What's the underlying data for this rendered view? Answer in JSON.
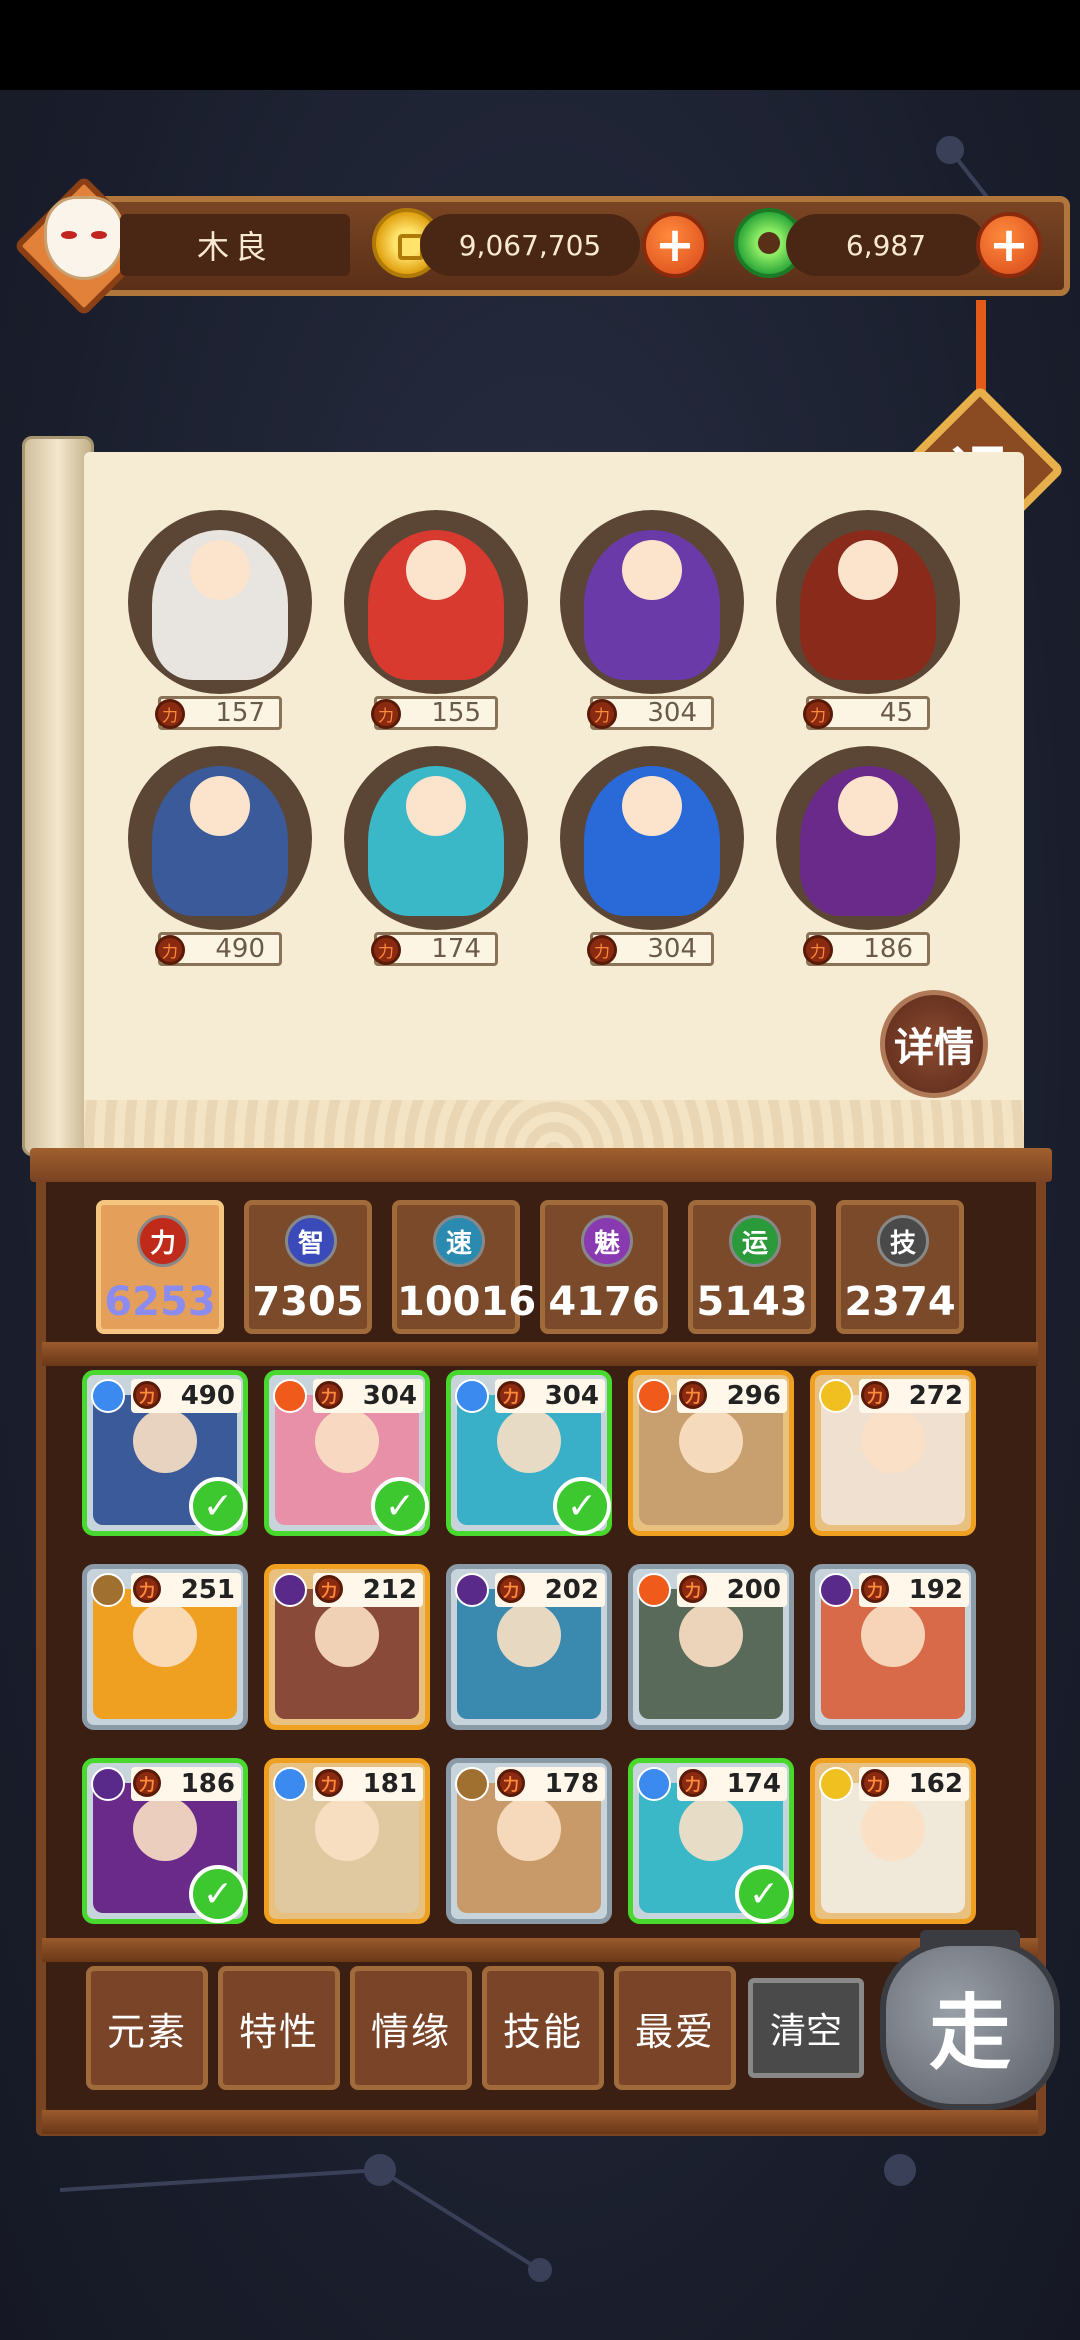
{
  "player": {
    "name": "木良"
  },
  "currency": {
    "gold": "9,067,705",
    "jade": "6,987"
  },
  "buttons": {
    "exit": "退",
    "detail": "详情",
    "go": "走",
    "clear": "清空",
    "plus": "+"
  },
  "team": [
    {
      "power": "157",
      "color": "#e8e4e0"
    },
    {
      "power": "155",
      "color": "#d83a30"
    },
    {
      "power": "304",
      "color": "#6a3aa8"
    },
    {
      "power": "45",
      "color": "#8a2a1a"
    },
    {
      "power": "490",
      "color": "#3a5a9a"
    },
    {
      "power": "174",
      "color": "#3ab8c8"
    },
    {
      "power": "304",
      "color": "#2a6ad8"
    },
    {
      "power": "186",
      "color": "#6a2a8a"
    }
  ],
  "stats": [
    {
      "label": "力",
      "value": "6253",
      "badge_color": "#c02a1a"
    },
    {
      "label": "智",
      "value": "7305",
      "badge_color": "#3a4ab8"
    },
    {
      "label": "速",
      "value": "10016",
      "badge_color": "#2a8ab0"
    },
    {
      "label": "魅",
      "value": "4176",
      "badge_color": "#8a3ab0"
    },
    {
      "label": "运",
      "value": "5143",
      "badge_color": "#2a9a3a"
    },
    {
      "label": "技",
      "value": "2374",
      "badge_color": "#4a4a4a"
    }
  ],
  "roster": [
    {
      "power": "490",
      "element": "water",
      "elem_color": "#3a8af0",
      "tier": "grey",
      "selected": true,
      "bg": "#3a5a9a"
    },
    {
      "power": "304",
      "element": "fire",
      "elem_color": "#f05a1a",
      "tier": "grey",
      "selected": true,
      "bg": "#e890a8"
    },
    {
      "power": "304",
      "element": "water",
      "elem_color": "#3a8af0",
      "tier": "grey",
      "selected": true,
      "bg": "#3ab0c8"
    },
    {
      "power": "296",
      "element": "fire",
      "elem_color": "#f05a1a",
      "tier": "orange",
      "selected": false,
      "bg": "#c8a070"
    },
    {
      "power": "272",
      "element": "light",
      "elem_color": "#f0c020",
      "tier": "orange",
      "selected": false,
      "bg": "#f0e0d0"
    },
    {
      "power": "251",
      "element": "earth",
      "elem_color": "#a07030",
      "tier": "grey",
      "selected": false,
      "bg": "#f0a020"
    },
    {
      "power": "212",
      "element": "dark",
      "elem_color": "#5a2a8a",
      "tier": "orange",
      "selected": false,
      "bg": "#8a4a3a"
    },
    {
      "power": "202",
      "element": "dark",
      "elem_color": "#5a2a8a",
      "tier": "grey",
      "selected": false,
      "bg": "#3a8ab0"
    },
    {
      "power": "200",
      "element": "fire",
      "elem_color": "#f05a1a",
      "tier": "grey",
      "selected": false,
      "bg": "#5a6a5a"
    },
    {
      "power": "192",
      "element": "dark",
      "elem_color": "#5a2a8a",
      "tier": "grey",
      "selected": false,
      "bg": "#d86a4a"
    },
    {
      "power": "186",
      "element": "dark",
      "elem_color": "#5a2a8a",
      "tier": "grey",
      "selected": true,
      "bg": "#6a2a8a"
    },
    {
      "power": "181",
      "element": "water",
      "elem_color": "#3a8af0",
      "tier": "orange",
      "selected": false,
      "bg": "#e0c8a0"
    },
    {
      "power": "178",
      "element": "earth",
      "elem_color": "#a07030",
      "tier": "grey",
      "selected": false,
      "bg": "#c89a6a"
    },
    {
      "power": "174",
      "element": "water",
      "elem_color": "#3a8af0",
      "tier": "grey",
      "selected": true,
      "bg": "#3ab8c8"
    },
    {
      "power": "162",
      "element": "light",
      "elem_color": "#f0c020",
      "tier": "orange",
      "selected": false,
      "bg": "#f0e8d8"
    }
  ],
  "filters": [
    "元素",
    "特性",
    "情缘",
    "技能",
    "最爱"
  ],
  "check_mark": "✓",
  "power_glyph": "力"
}
